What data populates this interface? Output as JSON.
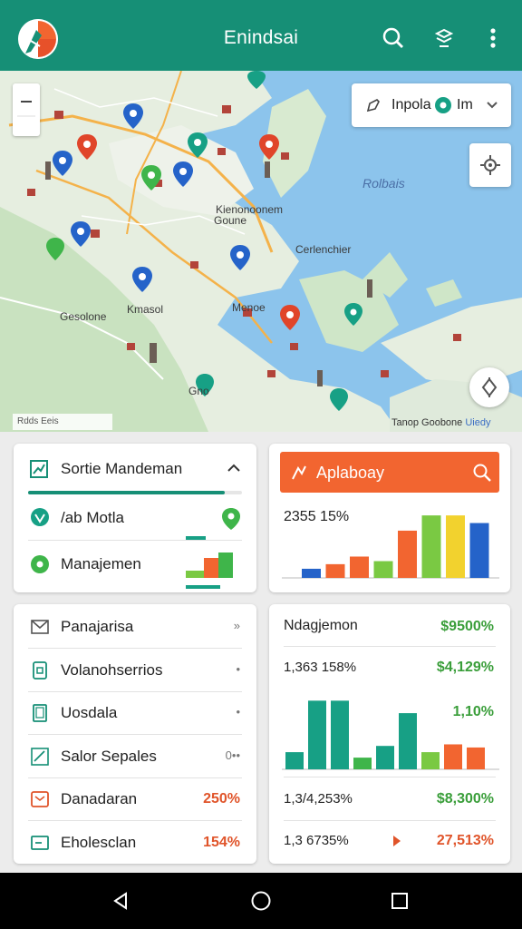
{
  "app": {
    "title": "Enindsai",
    "colors": {
      "primary": "#168f76",
      "accent": "#f26530",
      "green": "#3a9e3a",
      "blue": "#2563c9"
    }
  },
  "toolbar": {
    "icons": [
      "app-logo-icon",
      "search-icon",
      "layers-icon",
      "more-vert-icon"
    ]
  },
  "map": {
    "search": {
      "text": "Inpola",
      "suffix": "Im"
    },
    "labels": {
      "sea": "Rolbais",
      "city_a": "Kienonoonem",
      "city_a2": "Goune",
      "city_b": "Cerlenchier",
      "city_c": "Kmasol",
      "city_c2": "Gesolone",
      "city_d": "Menoe",
      "city_e": "Gno"
    },
    "scale": "Rdds Eeis",
    "attribution": {
      "text": "Tanop Goobone",
      "brand": "Uiedy"
    }
  },
  "card1": {
    "title": "Sortie Mandeman",
    "item1": "/ab Motla",
    "item2": "Manajemen"
  },
  "card2": {
    "header": "Aplaboay",
    "stat": "2355 15%",
    "chart_data": {
      "type": "bar",
      "series": [
        {
          "values": [
            12,
            18,
            28,
            22,
            62,
            82,
            82,
            72
          ]
        }
      ],
      "colors": [
        "#2563c9",
        "#f26530",
        "#f26530",
        "#7ac943",
        "#f26530",
        "#7ac943",
        "#f2d22e",
        "#2563c9"
      ]
    }
  },
  "card3": {
    "rows": [
      {
        "label": "Panajarisa",
        "value": "»"
      },
      {
        "label": "Volanohserrios",
        "value": "•"
      },
      {
        "label": "Uosdala",
        "value": "•"
      },
      {
        "label": "Salor Sepales",
        "value": "0••"
      },
      {
        "label": "Danadaran",
        "value": "250%"
      },
      {
        "label": "Eholesclan",
        "value": "154%"
      }
    ]
  },
  "card4": {
    "title": "Ndagjemon",
    "title_value": "$9500%",
    "stat1": "1,363 158%",
    "stat1_value": "$4,129%",
    "stat1b_value": "1,10%",
    "stat2": "1,3/4,253%",
    "stat2_value": "$8,300%",
    "stat3": "1,3 6735%",
    "stat3_value": "27,513%",
    "chart_data": {
      "type": "bar",
      "series": [
        {
          "values": [
            22,
            88,
            88,
            15,
            30,
            72,
            22,
            32,
            28
          ]
        }
      ],
      "colors": [
        "#17a085",
        "#17a085",
        "#17a085",
        "#3fb54a",
        "#17a085",
        "#17a085",
        "#7ac943",
        "#f26530",
        "#f26530"
      ]
    }
  },
  "navbar": {
    "icons": [
      "back-icon",
      "home-icon",
      "recents-icon"
    ]
  }
}
